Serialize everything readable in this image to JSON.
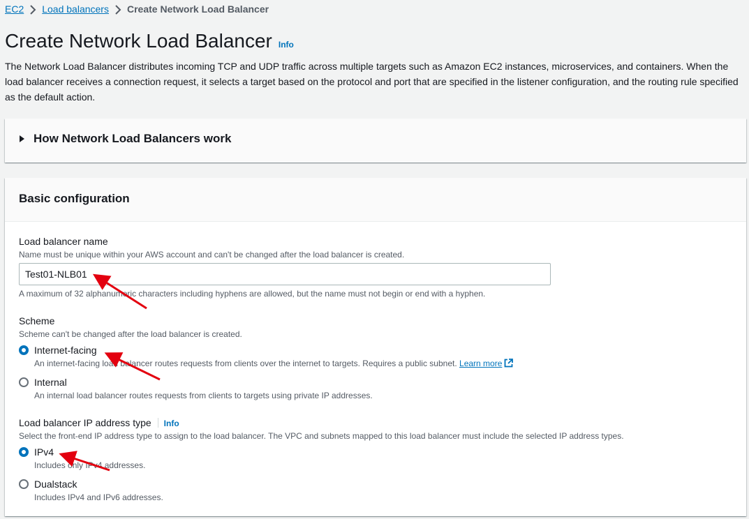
{
  "breadcrumb": {
    "items": [
      "EC2",
      "Load balancers"
    ],
    "current": "Create Network Load Balancer"
  },
  "header": {
    "title": "Create Network Load Balancer",
    "info_label": "Info",
    "description": "The Network Load Balancer distributes incoming TCP and UDP traffic across multiple targets such as Amazon EC2 instances, microservices, and containers. When the load balancer receives a connection request, it selects a target based on the protocol and port that are specified in the listener configuration, and the routing rule specified as the default action."
  },
  "how_it_works": {
    "title": "How Network Load Balancers work",
    "expanded": false
  },
  "basic_configuration": {
    "title": "Basic configuration",
    "name_field": {
      "label": "Load balancer name",
      "description": "Name must be unique within your AWS account and can't be changed after the load balancer is created.",
      "value": "Test01-NLB01",
      "constraint": "A maximum of 32 alphanumeric characters including hyphens are allowed, but the name must not begin or end with a hyphen."
    },
    "scheme": {
      "label": "Scheme",
      "description": "Scheme can't be changed after the load balancer is created.",
      "options": [
        {
          "label": "Internet-facing",
          "description": "An internet-facing load balancer routes requests from clients over the internet to targets. Requires a public subnet.",
          "link": "Learn more",
          "selected": true
        },
        {
          "label": "Internal",
          "description": "An internal load balancer routes requests from clients to targets using private IP addresses.",
          "selected": false
        }
      ]
    },
    "ip_type": {
      "label": "Load balancer IP address type",
      "info_label": "Info",
      "description": "Select the front-end IP address type to assign to the load balancer. The VPC and subnets mapped to this load balancer must include the selected IP address types.",
      "options": [
        {
          "label": "IPv4",
          "description": "Includes only IPv4 addresses.",
          "selected": true
        },
        {
          "label": "Dualstack",
          "description": "Includes IPv4 and IPv6 addresses.",
          "selected": false
        }
      ]
    }
  },
  "colors": {
    "link": "#0073bb",
    "annotation_arrow": "#e3000f",
    "page_bg": "#f2f3f3"
  }
}
